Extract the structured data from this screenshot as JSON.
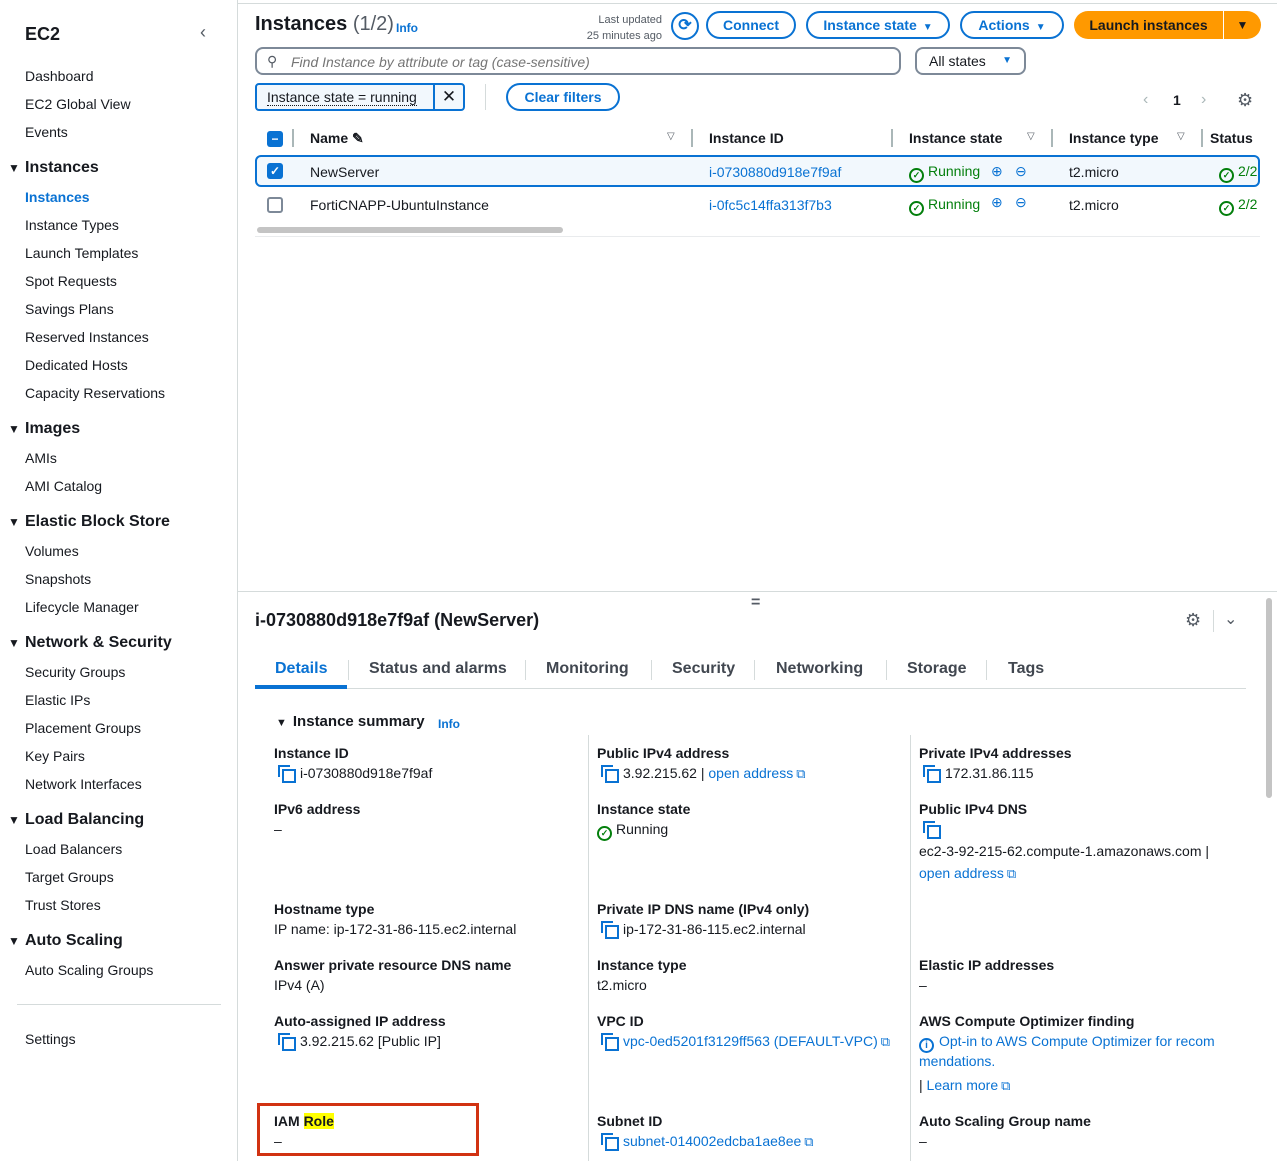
{
  "sidebar": {
    "title": "EC2",
    "collapse_icon": "‹",
    "top_items": [
      "Dashboard",
      "EC2 Global View",
      "Events"
    ],
    "sections": [
      {
        "title": "Instances",
        "items": [
          "Instances",
          "Instance Types",
          "Launch Templates",
          "Spot Requests",
          "Savings Plans",
          "Reserved Instances",
          "Dedicated Hosts",
          "Capacity Reservations"
        ]
      },
      {
        "title": "Images",
        "items": [
          "AMIs",
          "AMI Catalog"
        ]
      },
      {
        "title": "Elastic Block Store",
        "items": [
          "Volumes",
          "Snapshots",
          "Lifecycle Manager"
        ]
      },
      {
        "title": "Network & Security",
        "items": [
          "Security Groups",
          "Elastic IPs",
          "Placement Groups",
          "Key Pairs",
          "Network Interfaces"
        ]
      },
      {
        "title": "Load Balancing",
        "items": [
          "Load Balancers",
          "Target Groups",
          "Trust Stores"
        ]
      },
      {
        "title": "Auto Scaling",
        "items": [
          "Auto Scaling Groups"
        ]
      }
    ],
    "settings": "Settings"
  },
  "header": {
    "title": "Instances",
    "count": "(1/2)",
    "info": "Info",
    "last_updated_line1": "Last updated",
    "last_updated_line2": "25 minutes ago",
    "connect": "Connect",
    "instance_state": "Instance state",
    "actions": "Actions",
    "launch": "Launch instances"
  },
  "search": {
    "placeholder": "Find Instance by attribute or tag (case-sensitive)",
    "state_select": "All states"
  },
  "filter": {
    "token": "Instance state = running",
    "clear": "Clear filters"
  },
  "pager": {
    "page": "1"
  },
  "table": {
    "columns": [
      "Name",
      "Instance ID",
      "Instance state",
      "Instance type",
      "Status"
    ],
    "rows": [
      {
        "name": "NewServer",
        "id": "i-0730880d918e7f9af",
        "state": "Running",
        "type": "t2.micro",
        "status": "2/2",
        "selected": true
      },
      {
        "name": "FortiCNAPP-UbuntuInstance",
        "id": "i-0fc5c14ffa313f7b3",
        "state": "Running",
        "type": "t2.micro",
        "status": "2/2",
        "selected": false
      }
    ]
  },
  "details": {
    "title": "i-0730880d918e7f9af (NewServer)",
    "tabs": [
      "Details",
      "Status and alarms",
      "Monitoring",
      "Security",
      "Networking",
      "Storage",
      "Tags"
    ],
    "summary_title": "Instance summary",
    "summary_info": "Info",
    "fields": {
      "instance_id_label": "Instance ID",
      "instance_id": "i-0730880d918e7f9af",
      "public_ipv4_label": "Public IPv4 address",
      "public_ipv4": "3.92.215.62 |",
      "open_address": "open address",
      "private_ipv4_label": "Private IPv4 addresses",
      "private_ipv4": "172.31.86.115",
      "ipv6_label": "IPv6 address",
      "ipv6": "–",
      "instance_state_label": "Instance state",
      "instance_state": "Running",
      "public_dns_label": "Public IPv4 DNS",
      "public_dns": "ec2-3-92-215-62.compute-1.amazonaws.com |",
      "public_dns_open": "open address",
      "hostname_type_label": "Hostname type",
      "hostname_type": "IP name: ip-172-31-86-115.ec2.internal",
      "private_dns_label": "Private IP DNS name (IPv4 only)",
      "private_dns": "ip-172-31-86-115.ec2.internal",
      "answer_dns_label": "Answer private resource DNS name",
      "answer_dns": "IPv4 (A)",
      "instance_type_label": "Instance type",
      "instance_type": "t2.micro",
      "elastic_ip_label": "Elastic IP addresses",
      "elastic_ip": "–",
      "auto_ip_label": "Auto-assigned IP address",
      "auto_ip": "3.92.215.62 [Public IP]",
      "vpc_label": "VPC ID",
      "vpc": "vpc-0ed5201f3129ff563 (DEFAULT-VPC)",
      "optimizer_label": "AWS Compute Optimizer finding",
      "optimizer_line1": "Opt-in to AWS Compute Optimizer for recom",
      "optimizer_line2": "mendations.",
      "learn_more": "Learn more",
      "iam_label_1": "IAM",
      "iam_label_2": "Role",
      "iam_value": "–",
      "subnet_label": "Subnet ID",
      "subnet": "subnet-014002edcba1ae8ee",
      "asg_label": "Auto Scaling Group name",
      "asg": "–"
    }
  }
}
